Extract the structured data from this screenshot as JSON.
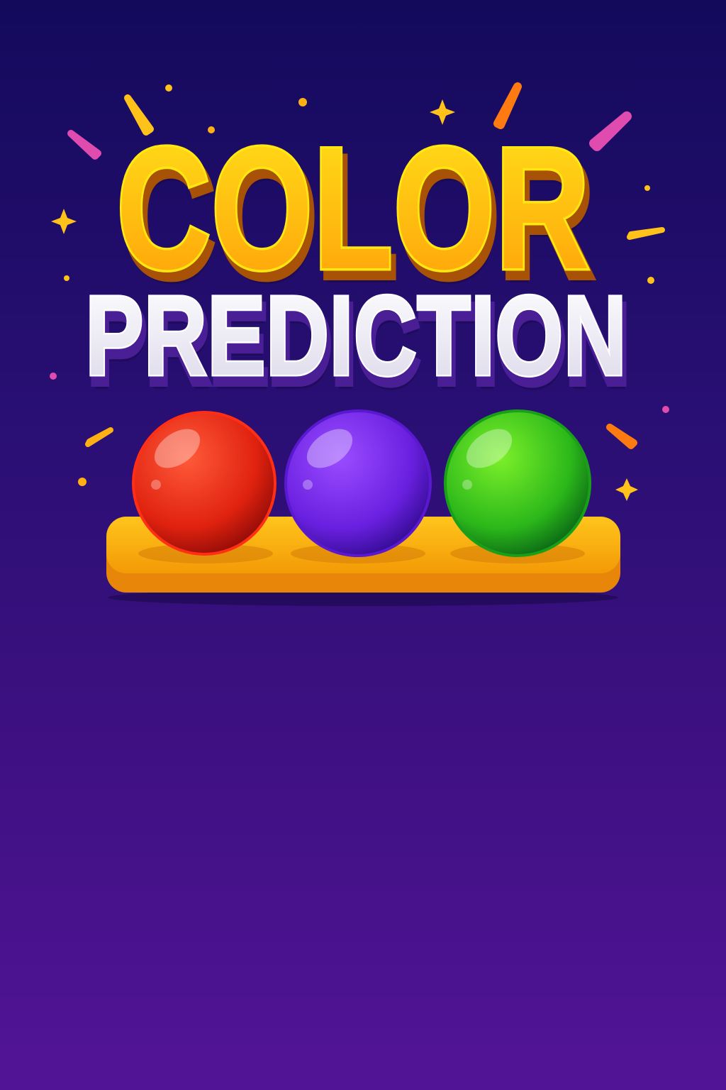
{
  "title": {
    "line1": "COLOR",
    "line2": "PREDICTION"
  },
  "balls": [
    {
      "name": "red",
      "color": "#e8251a"
    },
    {
      "name": "violet",
      "color": "#6a22e0"
    },
    {
      "name": "green",
      "color": "#2cc21c"
    }
  ],
  "colors": {
    "title_gold": "#ffc20e",
    "title_white": "#f4f2fa",
    "tray": "#f6a90c"
  }
}
